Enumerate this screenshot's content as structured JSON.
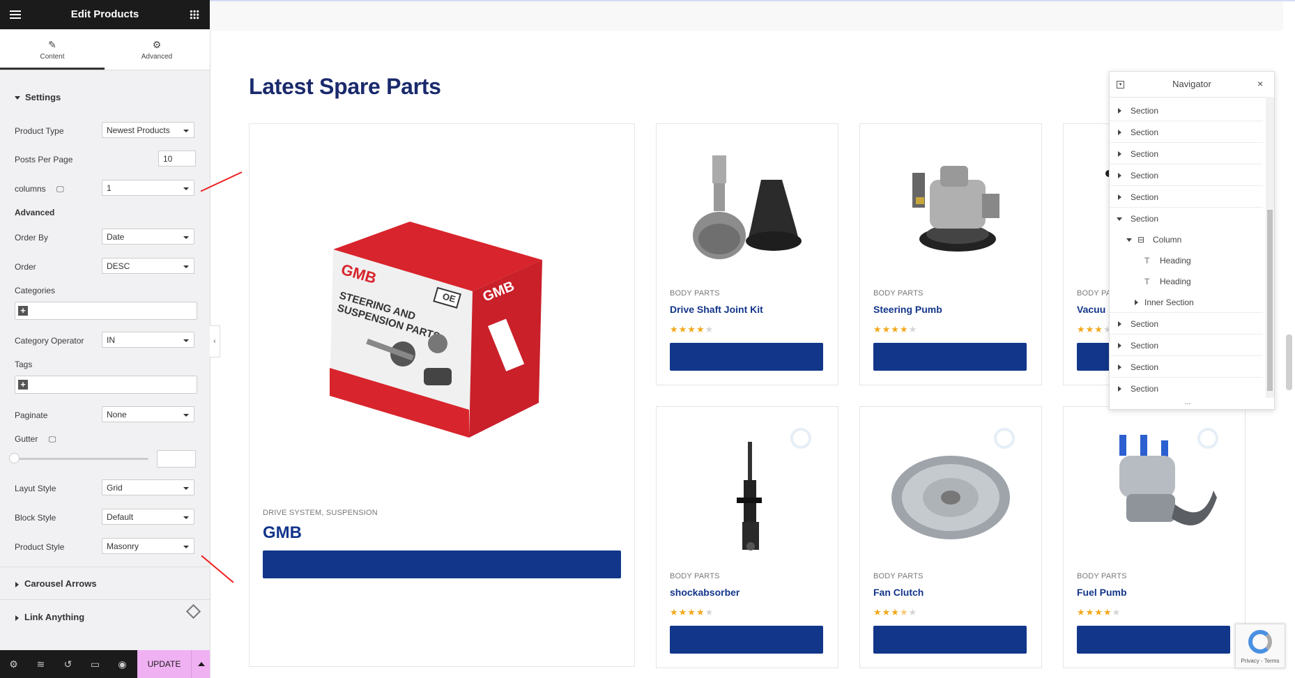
{
  "panel": {
    "title": "Edit Products",
    "tabs": [
      {
        "label": "Content"
      },
      {
        "label": "Advanced"
      }
    ],
    "settings_title": "Settings",
    "fields": {
      "product_type": {
        "label": "Product Type",
        "value": "Newest Products"
      },
      "posts_per_page": {
        "label": "Posts Per Page",
        "value": "10"
      },
      "columns": {
        "label": "columns",
        "value": "1"
      },
      "advanced_heading": "Advanced",
      "order_by": {
        "label": "Order By",
        "value": "Date"
      },
      "order": {
        "label": "Order",
        "value": "DESC"
      },
      "categories": {
        "label": "Categories"
      },
      "category_operator": {
        "label": "Category Operator",
        "value": "IN"
      },
      "tags": {
        "label": "Tags"
      },
      "paginate": {
        "label": "Paginate",
        "value": "None"
      },
      "gutter": {
        "label": "Gutter",
        "value": ""
      },
      "layout_style": {
        "label": "Layut Style",
        "value": "Grid"
      },
      "block_style": {
        "label": "Block Style",
        "value": "Default"
      },
      "product_style": {
        "label": "Product Style",
        "value": "Masonry"
      }
    },
    "carousel_arrows": "Carousel Arrows",
    "link_anything": "Link Anything",
    "update_label": "UPDATE"
  },
  "main": {
    "heading": "Latest Spare Parts",
    "featured": {
      "category": "DRIVE SYSTEM, SUSPENSION",
      "title": "GMB"
    },
    "products": [
      {
        "category": "BODY PARTS",
        "title": "Drive Shaft Joint Kit",
        "rating": 4
      },
      {
        "category": "BODY PARTS",
        "title": "Steering Pumb",
        "rating": 4
      },
      {
        "category": "BODY PA",
        "title": "Vacuu",
        "rating": 3
      },
      {
        "category": "BODY PARTS",
        "title": "shockabsorber",
        "rating": 4.5
      },
      {
        "category": "BODY PARTS",
        "title": "Fan Clutch",
        "rating": 3.5
      },
      {
        "category": "BODY PARTS",
        "title": "Fuel Pumb",
        "rating": 4
      }
    ],
    "box_text": {
      "brand": "GMB",
      "line1": "STEERING AND",
      "line2": "SUSPENSION PARTS",
      "badge": "OE"
    }
  },
  "navigator": {
    "title": "Navigator",
    "items": [
      {
        "label": "Section"
      },
      {
        "label": "Section"
      },
      {
        "label": "Section"
      },
      {
        "label": "Section"
      },
      {
        "label": "Section"
      },
      {
        "label": "Section"
      },
      {
        "label": "Column"
      },
      {
        "label": "Heading"
      },
      {
        "label": "Heading"
      },
      {
        "label": "Inner Section"
      },
      {
        "label": "Section"
      },
      {
        "label": "Section"
      },
      {
        "label": "Section"
      },
      {
        "label": "Section"
      }
    ],
    "more": "..."
  },
  "recaptcha": {
    "text": "Privacy - Terms"
  },
  "colors": {
    "primary": "#12378a",
    "heading": "#1a2a6c",
    "star": "#f3a81c",
    "update_bg": "#f0b1f3"
  }
}
